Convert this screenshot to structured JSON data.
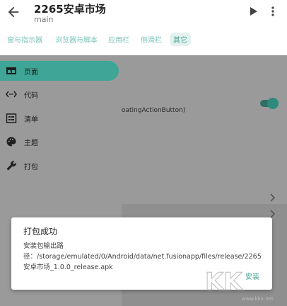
{
  "appbar": {
    "title": "2265安卓市场",
    "subtitle": "main"
  },
  "tabs": [
    {
      "label": "窗与指示器"
    },
    {
      "label": "浏览器与脚本"
    },
    {
      "label": "应用栏"
    },
    {
      "label": "侧滑栏"
    },
    {
      "label": "其它"
    }
  ],
  "content": {
    "fab_text": "oatingActionButton)"
  },
  "drawer": {
    "items": [
      {
        "label": "页面",
        "icon": "page-icon",
        "active": true
      },
      {
        "label": "代码",
        "icon": "code-icon",
        "active": false
      },
      {
        "label": "清单",
        "icon": "manifest-icon",
        "active": false
      },
      {
        "label": "主题",
        "icon": "palette-icon",
        "active": false
      },
      {
        "label": "打包",
        "icon": "wrench-icon",
        "active": false
      }
    ]
  },
  "dialog": {
    "title": "打包成功",
    "body": "安装包输出路径：/storage/emulated/0/Android/data/net.fusionapp/files/release/2265安卓市场_1.0.0_release.apk",
    "button": "安装"
  },
  "watermark": {
    "text": "KK",
    "url": "www.kkx.net"
  },
  "colors": {
    "accent": "#3fa596",
    "tab_text": "#7cc4b8",
    "scrim": "#8f8f8f"
  }
}
